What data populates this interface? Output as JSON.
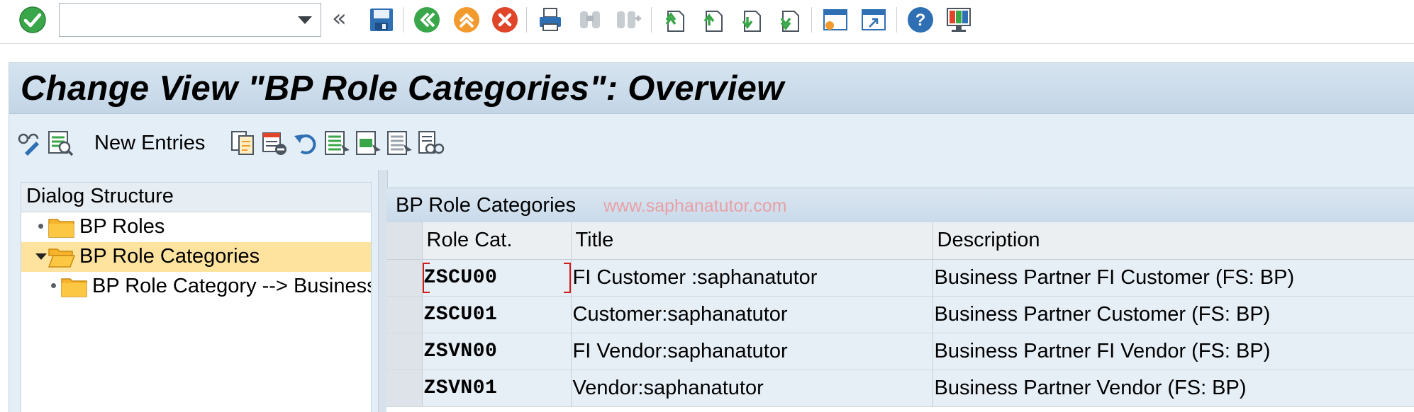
{
  "system_toolbar": {
    "command_field": {
      "value": "",
      "placeholder": ""
    },
    "icons": [
      "enter-icon",
      "save-icon",
      "back-icon",
      "exit-icon",
      "cancel-icon",
      "print-icon",
      "find-icon",
      "find-next-icon",
      "first-page-icon",
      "previous-page-icon",
      "next-page-icon",
      "last-page-icon",
      "create-session-icon",
      "shortcut-icon",
      "help-icon",
      "layout-menu-icon"
    ]
  },
  "page": {
    "title": "Change View \"BP Role Categories\": Overview"
  },
  "app_toolbar": {
    "new_entries_label": "New Entries",
    "icons": [
      "display-change-icon",
      "details-icon",
      "copy-as-icon",
      "delete-icon",
      "undo-change-icon",
      "select-all-icon",
      "select-block-icon",
      "deselect-all-icon",
      "configuration-icon"
    ]
  },
  "dialog_structure": {
    "title": "Dialog Structure",
    "items": [
      {
        "label": "BP Roles",
        "state": "collapsed"
      },
      {
        "label": "BP Role Categories",
        "state": "expanded",
        "selected": true
      },
      {
        "label": "BP Role Category --> Business",
        "state": "collapsed"
      }
    ]
  },
  "table": {
    "title": "BP Role Categories",
    "watermark": "www.saphanatutor.com",
    "columns": [
      "Role Cat.",
      "Title",
      "Description"
    ],
    "rows": [
      {
        "role_cat": "ZSCU00",
        "title": "FI Customer :saphanatutor",
        "description": "Business Partner FI Customer (FS: BP)"
      },
      {
        "role_cat": "ZSCU01",
        "title": "Customer:saphanatutor",
        "description": "Business Partner Customer (FS: BP)"
      },
      {
        "role_cat": "ZSVN00",
        "title": "FI Vendor:saphanatutor",
        "description": "Business Partner FI Vendor (FS: BP)"
      },
      {
        "role_cat": "ZSVN01",
        "title": "Vendor:saphanatutor",
        "description": "Business Partner Vendor (FS: BP)"
      }
    ]
  },
  "colors": {
    "title_bar": "#c3d5e6",
    "selected_tree_item": "#fde39e",
    "enter_green": "#3aa64a",
    "cancel_red": "#e0452a",
    "focus_marker": "#d11a1a"
  }
}
